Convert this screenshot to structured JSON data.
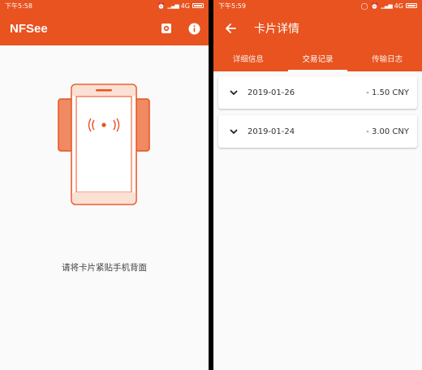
{
  "left": {
    "status": {
      "time": "下午5:58",
      "network": "4G"
    },
    "appbar": {
      "title": "NFSee",
      "icons": [
        "settings-icon",
        "info-icon"
      ]
    },
    "hint": "请将卡片紧贴手机背面",
    "illustration": "nfc-phone-card-icon"
  },
  "right": {
    "status": {
      "time": "下午5:59",
      "network": "4G"
    },
    "appbar": {
      "title": "卡片详情",
      "back_icon": "arrow-left-icon"
    },
    "tabs": [
      {
        "label": "详细信息",
        "active": false
      },
      {
        "label": "交易记录",
        "active": true
      },
      {
        "label": "传输日志",
        "active": false
      }
    ],
    "transactions": [
      {
        "date": "2019-01-26",
        "amount": "- 1.50 CNY"
      },
      {
        "date": "2019-01-24",
        "amount": "- 3.00 CNY"
      }
    ]
  },
  "colors": {
    "accent": "#e8531f",
    "background": "#fafafa",
    "illustration_light": "#f08a62"
  }
}
